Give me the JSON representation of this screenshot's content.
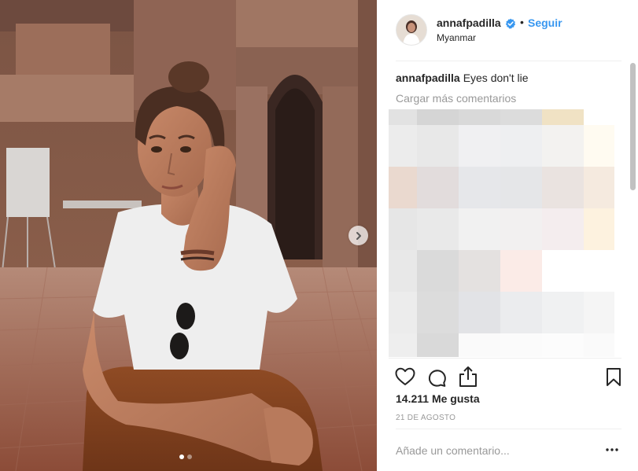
{
  "post": {
    "username": "annafpadilla",
    "follow_label": "Seguir",
    "separator": "•",
    "location": "Myanmar",
    "verified": true,
    "caption_user": "annafpadilla",
    "caption_text": "Eyes don't lie",
    "load_more_label": "Cargar más comentarios",
    "likes_text": "14.211 Me gusta",
    "date_text": "21 DE AGOSTO",
    "comment_placeholder": "Añade un comentario...",
    "carousel_total": 2,
    "carousel_active": 1
  },
  "icons": {
    "verified": "verified-badge-icon",
    "next": "chevron-right-icon",
    "like": "heart-icon",
    "comment": "comment-bubble-icon",
    "share": "share-icon",
    "save": "bookmark-icon",
    "more": "more-options-icon"
  },
  "colors": {
    "link": "#3897f0",
    "text": "#262626",
    "muted": "#999999",
    "divider": "#efefef"
  }
}
